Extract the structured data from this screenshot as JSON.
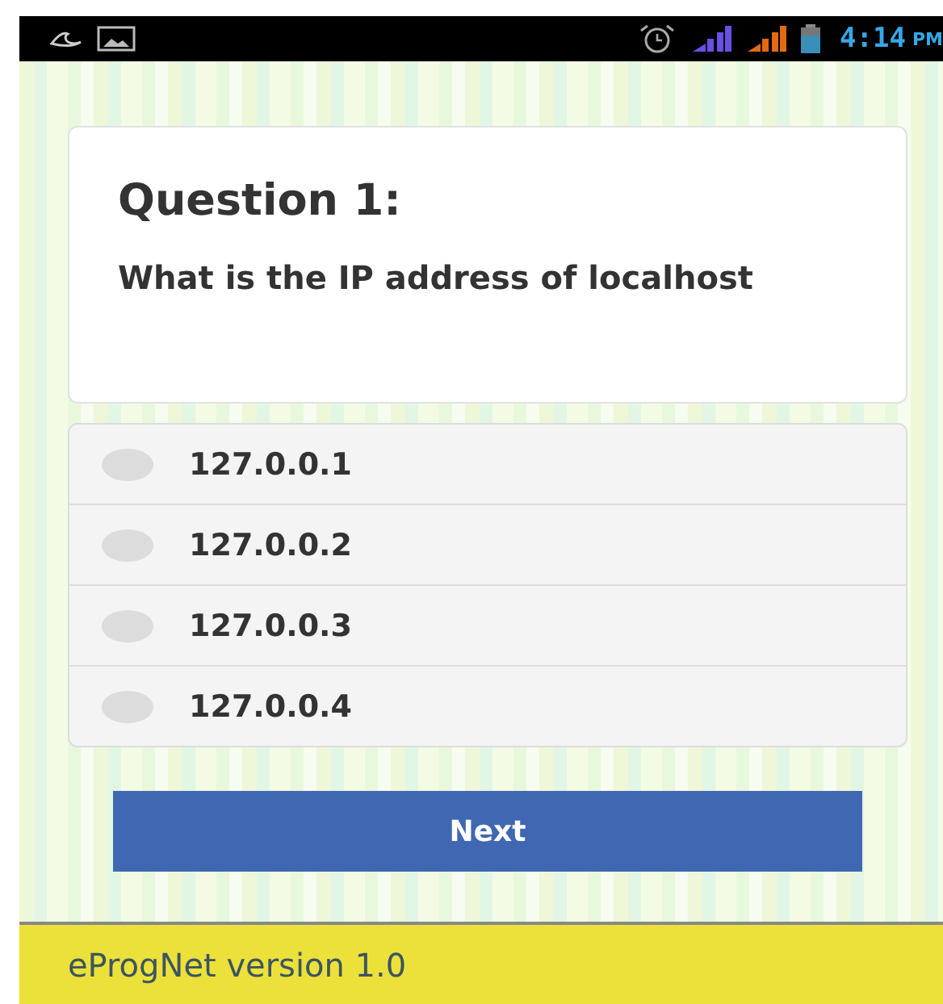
{
  "status_bar": {
    "time": "4:14",
    "period": "PM"
  },
  "question": {
    "title": "Question 1:",
    "text": "What is the IP address of localhost"
  },
  "options": [
    {
      "label": "127.0.0.1",
      "selected": false
    },
    {
      "label": "127.0.0.2",
      "selected": false
    },
    {
      "label": "127.0.0.3",
      "selected": false
    },
    {
      "label": "127.0.0.4",
      "selected": false
    }
  ],
  "next_button": "Next",
  "footer": "eProgNet version 1.0"
}
